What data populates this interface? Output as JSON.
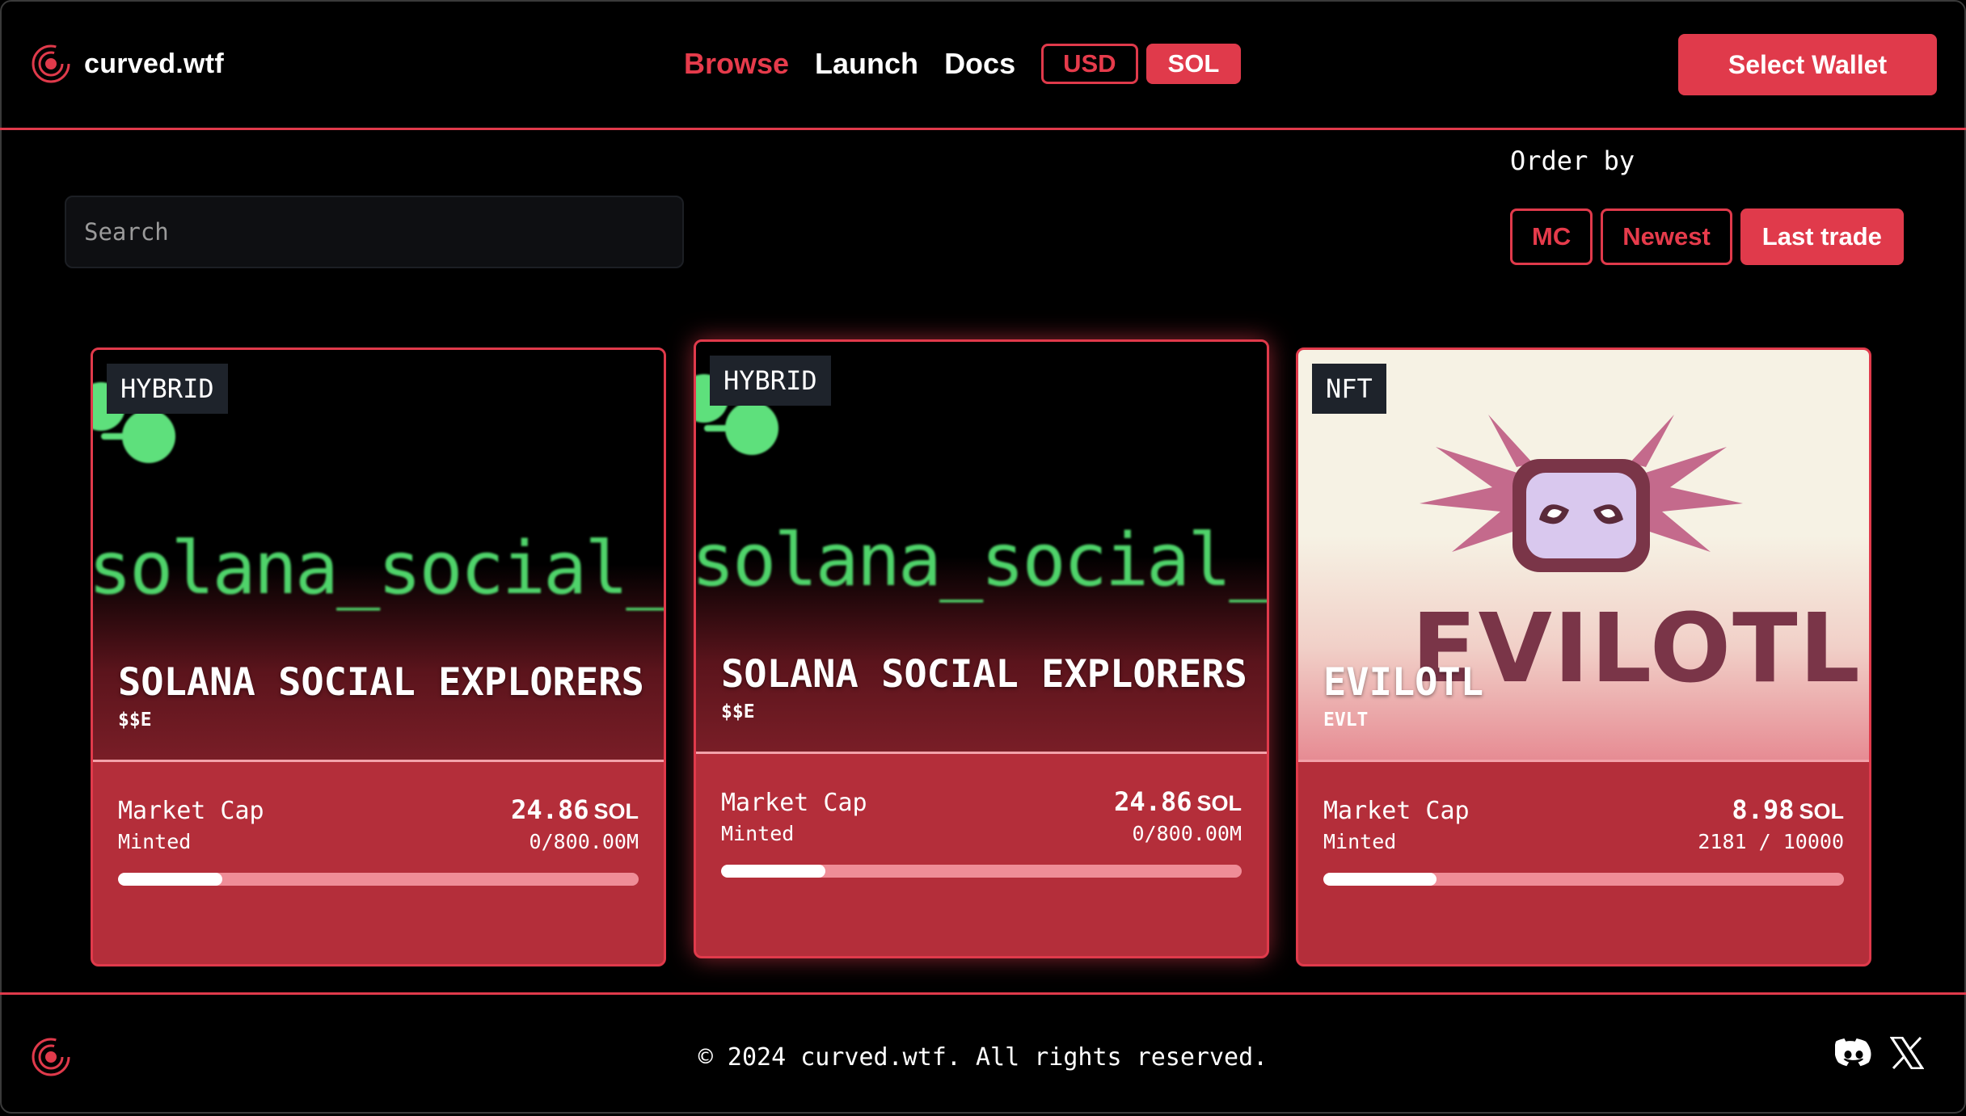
{
  "header": {
    "brand": "curved.wtf",
    "nav": [
      "Browse",
      "Launch",
      "Docs"
    ],
    "currency": [
      "USD",
      "SOL"
    ],
    "wallet_button": "Select Wallet"
  },
  "search": {
    "placeholder": "Search"
  },
  "order": {
    "label": "Order by",
    "options": [
      "MC",
      "Newest",
      "Last trade"
    ]
  },
  "cards": [
    {
      "badge": "HYBRID",
      "cover_text": "solana_social_e",
      "name": "SOLANA SOCIAL EXPLORERS",
      "ticker": "$$E",
      "market_cap_label": "Market Cap",
      "market_cap_value": "24.86",
      "market_cap_unit": "SOL",
      "minted_label": "Minted",
      "minted_value": "0/800.00M",
      "progress": 0.2
    },
    {
      "badge": "HYBRID",
      "cover_text": "solana_social_e",
      "name": "SOLANA SOCIAL EXPLORERS",
      "ticker": "$$E",
      "market_cap_label": "Market Cap",
      "market_cap_value": "24.86",
      "market_cap_unit": "SOL",
      "minted_label": "Minted",
      "minted_value": "0/800.00M",
      "progress": 0.2
    },
    {
      "badge": "NFT",
      "cover_text": "EVILOTL",
      "name": "EVILOTL",
      "ticker": "EVLT",
      "market_cap_label": "Market Cap",
      "market_cap_value": "8.98",
      "market_cap_unit": "SOL",
      "minted_label": "Minted",
      "minted_value": "2181 / 10000",
      "progress": 0.218
    }
  ],
  "footer": {
    "copyright": "© 2024 curved.wtf. All rights reserved."
  },
  "colors": {
    "accent": "#e03a4b",
    "card_bg": "#b42e3a",
    "progress_track": "#ef8d97",
    "cover_green": "#4fd36a"
  },
  "icons": [
    "curved-logo-icon",
    "discord-icon",
    "x-icon"
  ]
}
